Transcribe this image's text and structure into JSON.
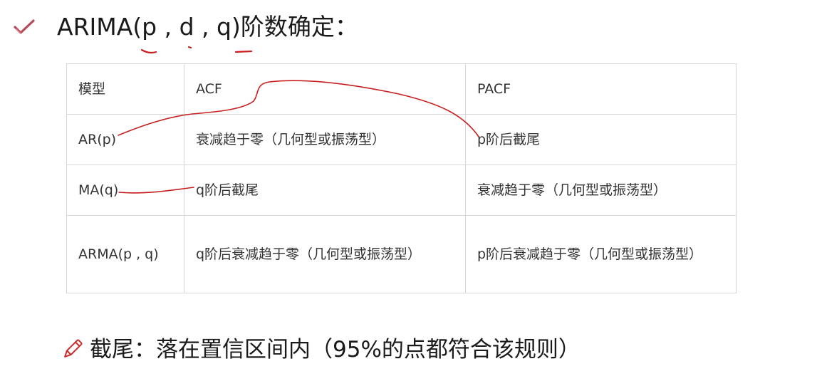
{
  "title": "ARIMA(p , d , q)阶数确定：",
  "table": {
    "headers": [
      "模型",
      "ACF",
      "PACF"
    ],
    "rows": [
      [
        "AR(p)",
        "衰减趋于零（几何型或振荡型）",
        "p阶后截尾"
      ],
      [
        "MA(q)",
        "q阶后截尾",
        "衰减趋于零（几何型或振荡型）"
      ],
      [
        "ARMA(p , q)",
        "q阶后衰减趋于零（几何型或振荡型）",
        "p阶后衰减趋于零（几何型或振荡型）"
      ]
    ]
  },
  "footer": "截尾：落在置信区间内（95%的点都符合该规则）",
  "colors": {
    "check_icon": "#b84a58",
    "pencil_icon": "#cc2b2b",
    "annotation_ink": "#c81e1e"
  },
  "icons": [
    "check-icon",
    "pencil-icon"
  ]
}
